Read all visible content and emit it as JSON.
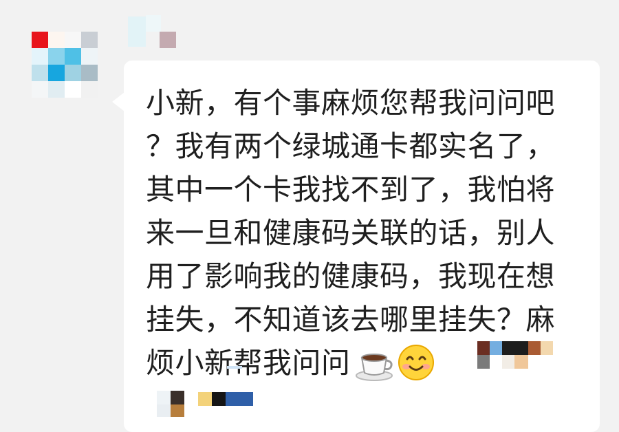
{
  "message": {
    "lines": [
      "小新，有个事麻烦您帮我问问吧",
      "？我有两个绿城通卡都实名了，",
      "其中一个卡我找不到了，我怕将",
      "来一旦和健康码关联的话，别人",
      "用了影响我的健康码，我现在想",
      "挂失，不知道该去哪里挂失？麻",
      "烦小新帮我问问"
    ]
  },
  "emojis": [
    "coffee-emoji",
    "smiling-face-emoji"
  ],
  "colors": {
    "background": "#f2f2f2",
    "bubble": "#ffffff",
    "text": "#1f1f1f"
  }
}
